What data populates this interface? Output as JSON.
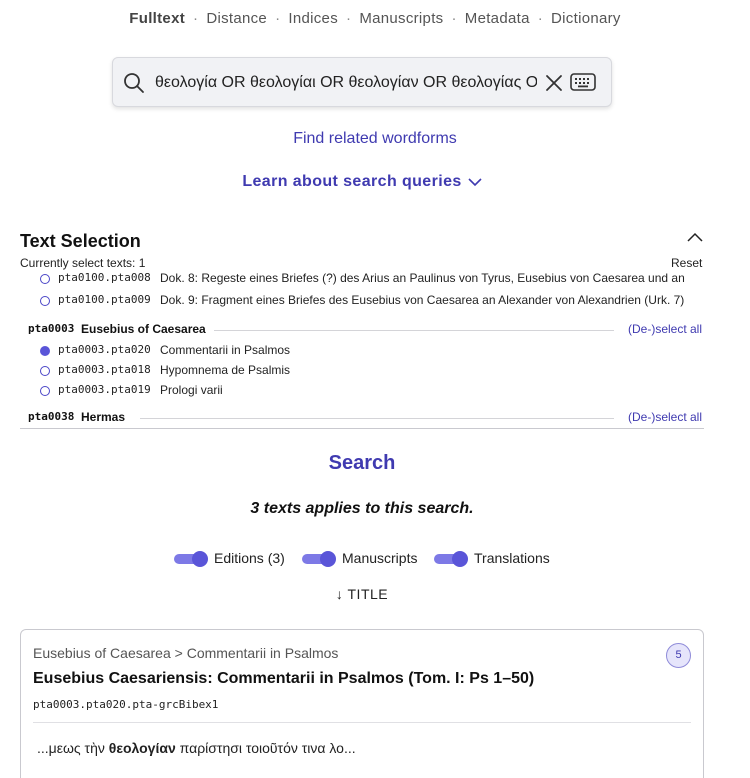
{
  "nav": {
    "items": [
      "Fulltext",
      "Distance",
      "Indices",
      "Manuscripts",
      "Metadata",
      "Dictionary"
    ],
    "separator": "·"
  },
  "search": {
    "query": "θεολογία OR θεολογίαι OR θεολογίαν OR θεολογίας OR"
  },
  "links": {
    "related": "Find related wordforms",
    "learn": "Learn about search queries"
  },
  "selection": {
    "title": "Text Selection",
    "count_text": "Currently select texts: 1",
    "reset_label": "Reset",
    "partial_row": {
      "code": "pta0100.pta008",
      "title": "Dok. 8: Regeste eines Briefes (?) des Arius an Paulinus von Tyrus, Eusebius von Caesarea und an"
    },
    "row_pta0100_009": {
      "code": "pta0100.pta009",
      "title": "Dok. 9: Fragment eines Briefes des Eusebius von Caesarea an Alexander von Alexandrien (Urk. 7)"
    },
    "group_eusebius": {
      "code": "pta0003",
      "name": "Eusebius of Caesarea",
      "toggle": "(De-)select all"
    },
    "rows_eusebius": [
      {
        "code": "pta0003.pta020",
        "title": "Commentarii in Psalmos",
        "selected": true
      },
      {
        "code": "pta0003.pta018",
        "title": "Hypomnema de Psalmis",
        "selected": false
      },
      {
        "code": "pta0003.pta019",
        "title": "Prologi varii",
        "selected": false
      }
    ],
    "group_hermas": {
      "code": "pta0038",
      "name": "Hermas",
      "toggle": "(De-)select all"
    }
  },
  "results": {
    "heading": "Search",
    "applies": "3 texts applies to this search.",
    "toggles": [
      {
        "label": "Editions (3)",
        "on": true
      },
      {
        "label": "Manuscripts",
        "on": true
      },
      {
        "label": "Translations",
        "on": true
      }
    ],
    "sort_label": "↓ TITLE"
  },
  "card": {
    "breadcrumb": "Eusebius of Caesarea > Commentarii in Psalmos",
    "badge": "5",
    "title": "Eusebius Caesariensis: Commentarii in Psalmos (Tom. I: Ps 1–50)",
    "id": "pta0003.pta020.pta-grcBibex1",
    "snippet_pre": "...μεως τὴν ",
    "snippet_hit": "θεολογίαν",
    "snippet_post": " παρίστησι τοιοῦτόν τινα λο..."
  },
  "colors": {
    "accent": "#3f3ab0",
    "toggle": "#5a55d8"
  }
}
